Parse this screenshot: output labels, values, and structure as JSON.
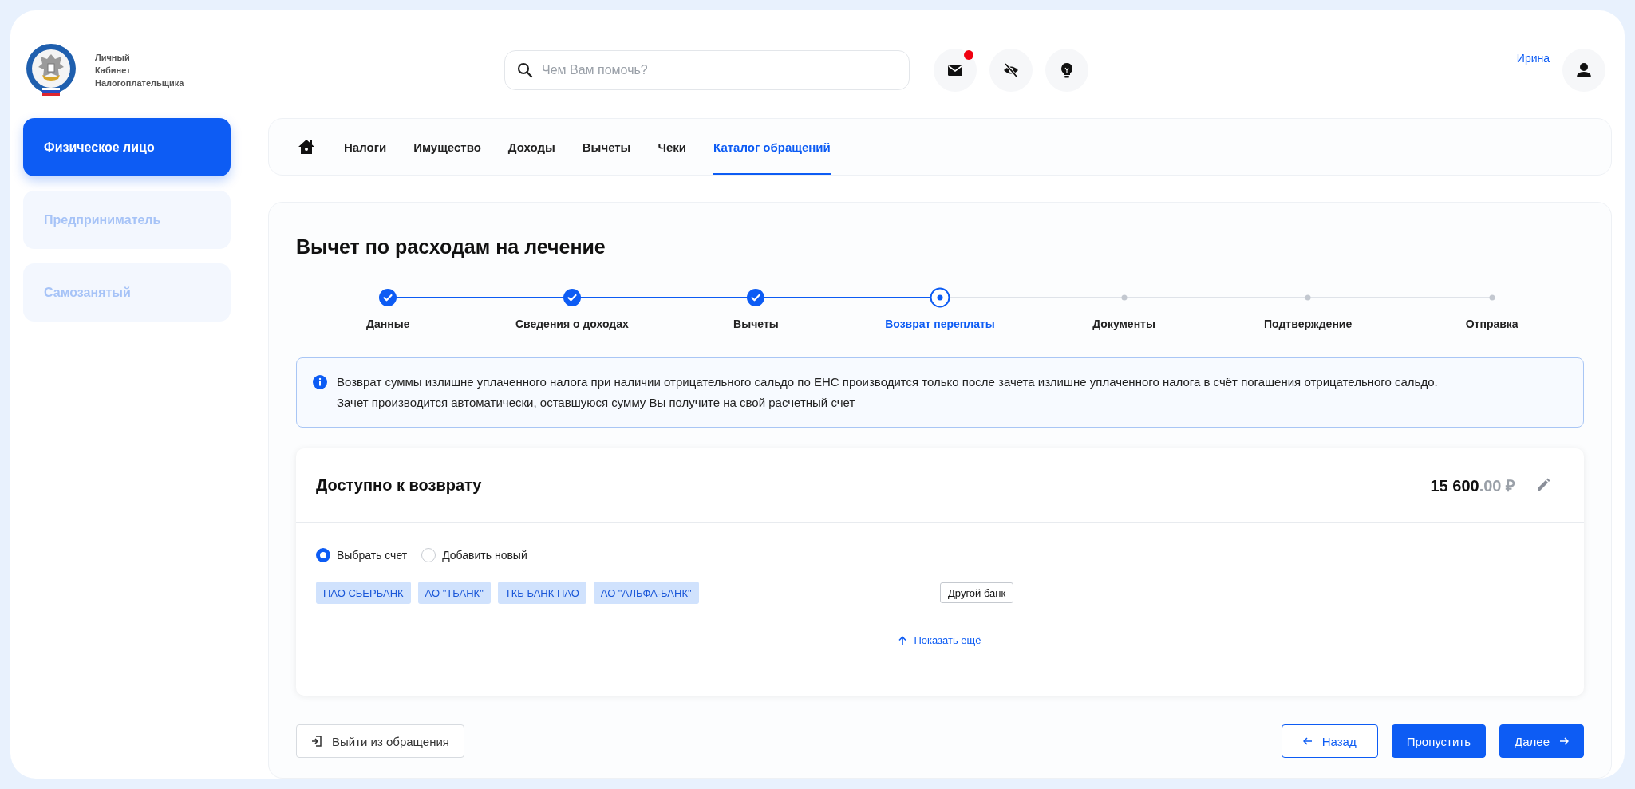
{
  "brand": {
    "lines": [
      "Личный",
      "Кабинет",
      "Налогоплательщика"
    ]
  },
  "search": {
    "placeholder": "Чем Вам помочь?"
  },
  "header_icons": [
    {
      "kind": "mail",
      "badge": true
    },
    {
      "kind": "eye",
      "badge": false
    },
    {
      "kind": "bulb",
      "badge": false
    }
  ],
  "user": {
    "name": "Ирина"
  },
  "sidebar": {
    "items": [
      {
        "label": "Физическое лицо",
        "selected": true
      },
      {
        "label": "Предприниматель",
        "selected": false
      },
      {
        "label": "Самозанятый",
        "selected": false
      }
    ]
  },
  "nav": {
    "items": [
      {
        "label": "Налоги",
        "selected": false
      },
      {
        "label": "Имущество",
        "selected": false
      },
      {
        "label": "Доходы",
        "selected": false
      },
      {
        "label": "Вычеты",
        "selected": false
      },
      {
        "label": "Чеки",
        "selected": false
      },
      {
        "label": "Каталог обращений",
        "selected": true
      }
    ]
  },
  "page": {
    "title": "Вычет по расходам на лечение"
  },
  "steps": [
    {
      "label": "Данные",
      "kind": "done"
    },
    {
      "label": "Сведения о доходах",
      "kind": "done"
    },
    {
      "label": "Вычеты",
      "kind": "done"
    },
    {
      "label": "Возврат переплаты",
      "kind": "current"
    },
    {
      "label": "Документы",
      "kind": "pending"
    },
    {
      "label": "Подтверждение",
      "kind": "pending"
    },
    {
      "label": "Отправка",
      "kind": "pending"
    }
  ],
  "notice": {
    "text": "Возврат суммы излишне уплаченного налога при наличии отрицательного сальдо по ЕНС производится только после зачета излишне уплаченного налога в счёт погашения отрицательного сальдо. Зачет производится автоматически, оставшуюся сумму Вы получите на свой расчетный счет"
  },
  "refund": {
    "title": "Доступно к возврату",
    "amount_whole": "15 600",
    "amount_fraction": ".00 ₽",
    "account_options": [
      {
        "label": "Выбрать счет",
        "selected": true
      },
      {
        "label": "Добавить новый",
        "selected": false
      }
    ],
    "banks": [
      {
        "label": "ПАО СБЕРБАНК",
        "kind": "bank"
      },
      {
        "label": "АО \"ТБАНК\"",
        "kind": "bank"
      },
      {
        "label": "ТКБ БАНК ПАО",
        "kind": "bank"
      },
      {
        "label": "АО \"АЛЬФА-БАНК\"",
        "kind": "bank"
      },
      {
        "label": "Другой банк",
        "kind": "other"
      }
    ],
    "show_more": "Показать ещё"
  },
  "buttons": {
    "exit": "Выйти из обращения",
    "back": "Назад",
    "skip": "Пропустить",
    "next": "Далее"
  }
}
